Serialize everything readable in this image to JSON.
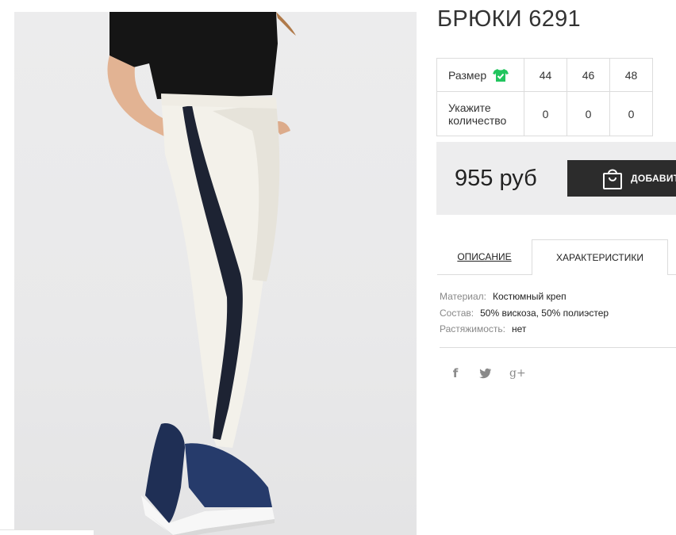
{
  "product": {
    "title": "БРЮКИ 6291",
    "image_alt": "Белые брюки с чёрными лампасами"
  },
  "sizes": {
    "size_label": "Размер",
    "quantity_label": "Укажите количество",
    "values": [
      "44",
      "46",
      "48"
    ],
    "quantities": [
      "0",
      "0",
      "0"
    ],
    "icon": "shirt-check-icon",
    "icon_color": "#22c55e"
  },
  "purchase": {
    "price": "955 руб",
    "add_button_label": "ДОБАВИТЬ"
  },
  "tabs": {
    "description": "ОПИСАНИЕ",
    "characteristics": "ХАРАКТЕРИСТИКИ",
    "active": "characteristics"
  },
  "specs": [
    {
      "key": "Материал:",
      "value": "Костюмный креп"
    },
    {
      "key": "Состав:",
      "value": "50% вискоза, 50% полиэстер"
    },
    {
      "key": "Растяжимость:",
      "value": "нет"
    }
  ],
  "social": {
    "facebook": "f",
    "twitter": "t",
    "googleplus": "g+"
  }
}
